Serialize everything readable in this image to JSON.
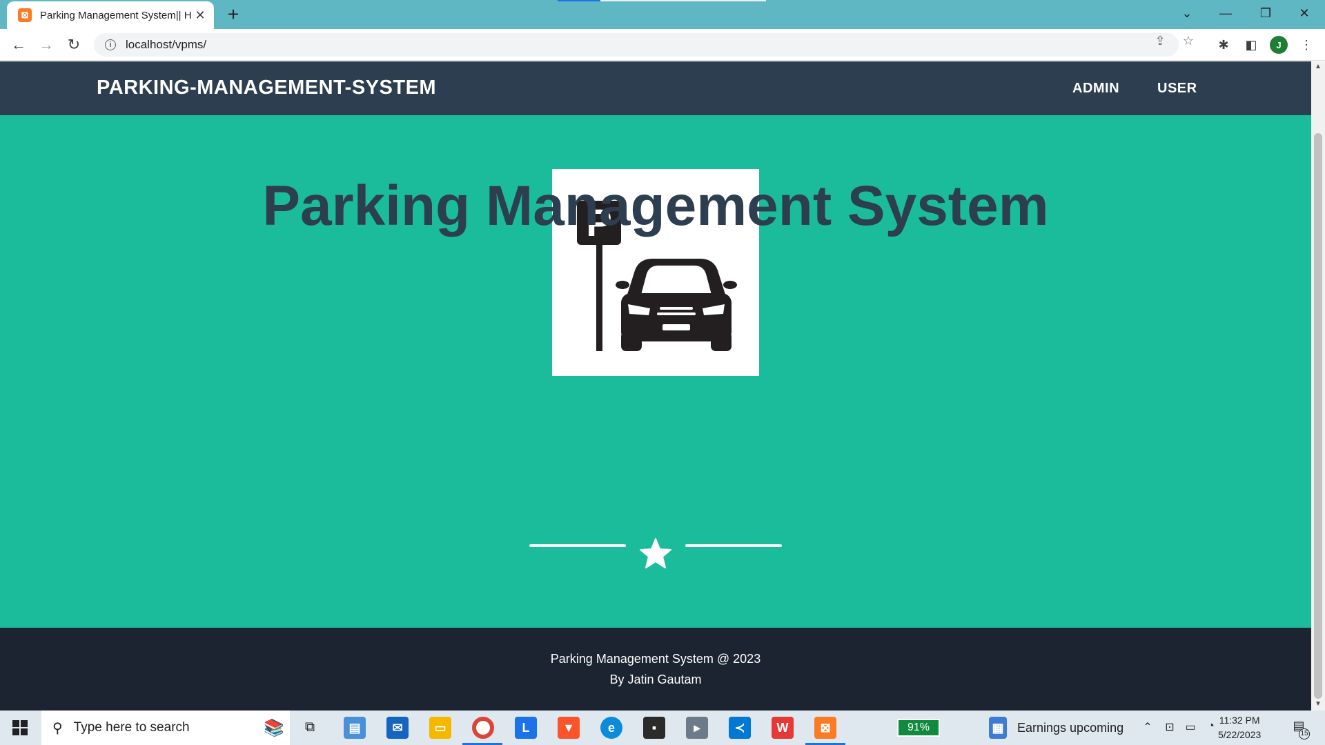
{
  "browser": {
    "tab_title": "Parking Management System|| Ho",
    "tab_favicon": "xampp-icon",
    "url": "localhost/vpms/",
    "profile_initial": "J"
  },
  "site": {
    "brand": "PARKING-MANAGEMENT-SYSTEM",
    "nav": [
      {
        "label": "ADMIN"
      },
      {
        "label": "USER"
      }
    ],
    "hero_title": "Parking Management System",
    "logo_sign_letter": "P",
    "footer_line1": "Parking Management System @ 2023",
    "footer_line2": "By Jatin Gautam"
  },
  "taskbar": {
    "search_placeholder": "Type here to search",
    "battery": "91%",
    "weather": "Earnings upcoming",
    "time": "11:32 PM",
    "date": "5/22/2023",
    "notifications": "15",
    "apps": [
      "files-icon",
      "mail-icon",
      "file-explorer-icon",
      "chrome-icon",
      "l-app-icon",
      "brave-icon",
      "edge-icon",
      "sticky-notes-icon",
      "media-icon",
      "vscode-icon",
      "wps-icon",
      "xampp-icon"
    ]
  },
  "colors": {
    "nav_bg": "#2c3e50",
    "hero_bg": "#1abc9c",
    "footer_bg": "#1c2331",
    "title_color": "#2c3e50"
  }
}
